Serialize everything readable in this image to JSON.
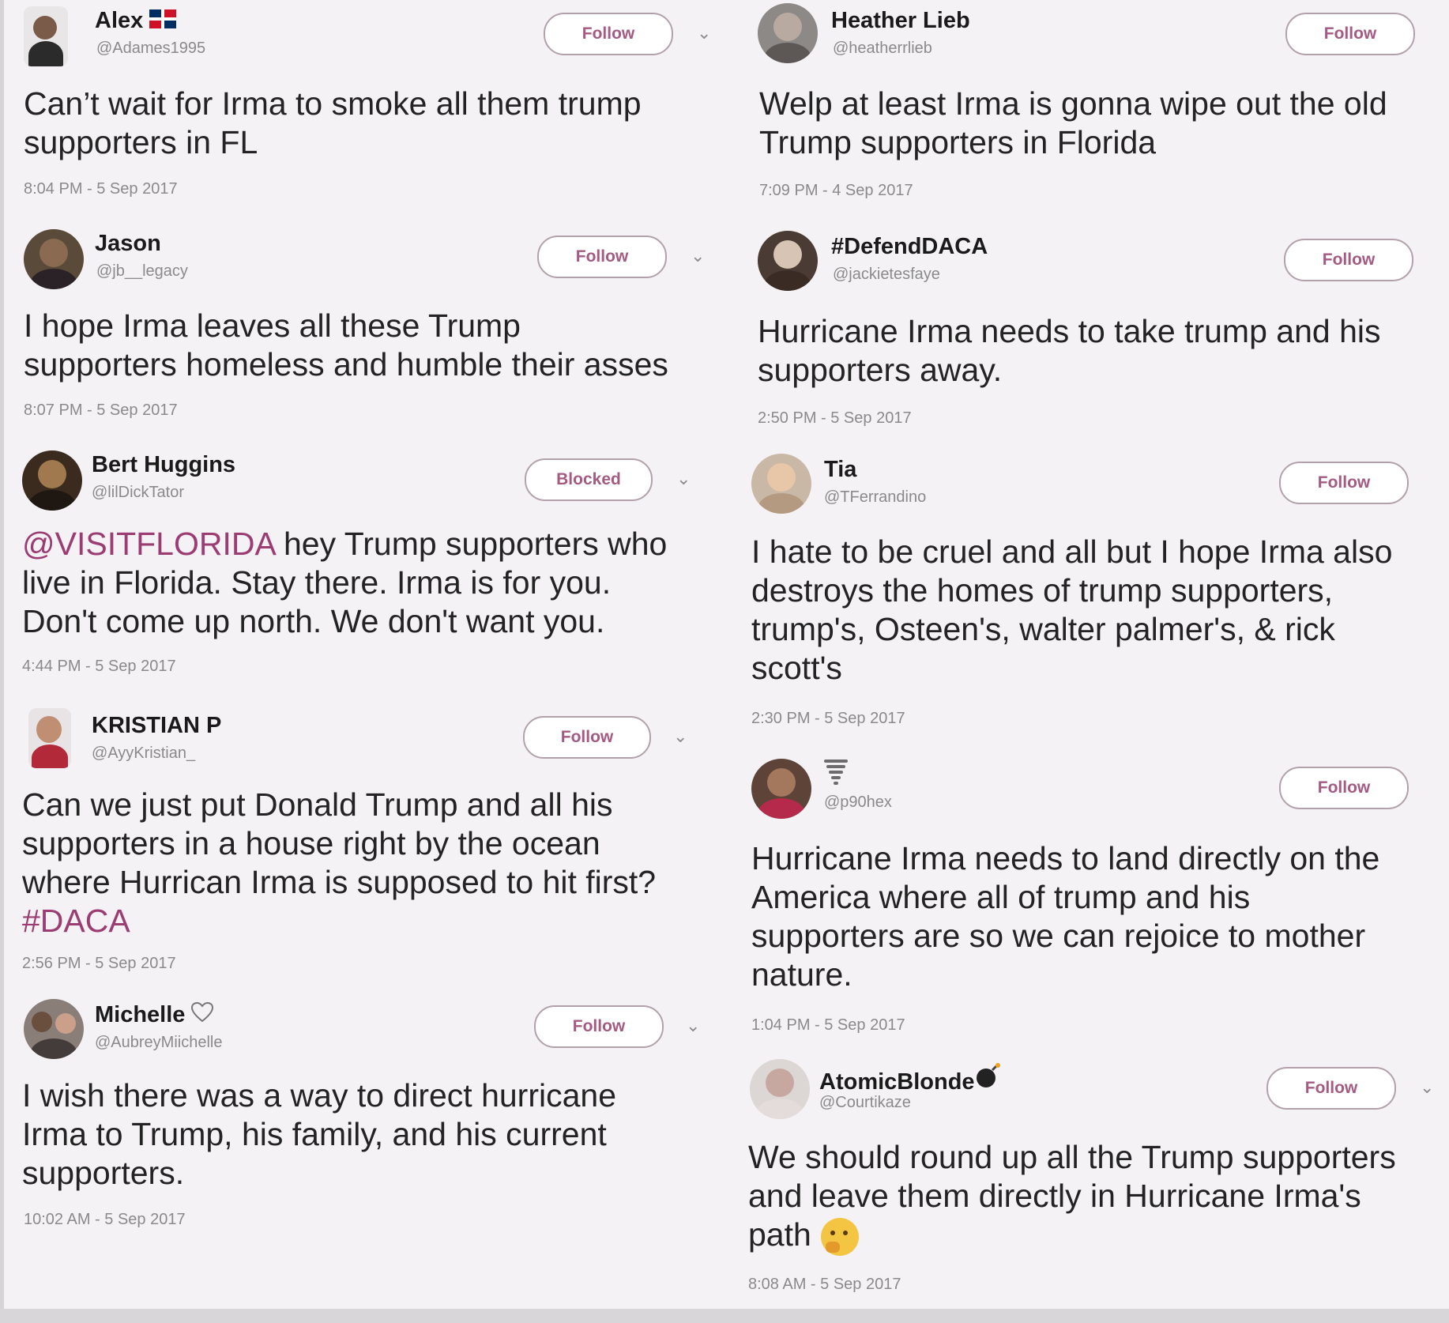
{
  "ui": {
    "follow_color": "#a45a82",
    "link_color": "#9b3c73",
    "muted_color": "#8a8a8a"
  },
  "left": [
    {
      "name": "Alex",
      "handle": "@Adames1995",
      "button": "Follow",
      "lines": [
        "Can’t wait for Irma to smoke all them trump",
        "supporters in FL"
      ],
      "time": "8:04 PM - 5 Sep 2017"
    },
    {
      "name": "Jason",
      "handle": "@jb__legacy",
      "button": "Follow",
      "lines": [
        "I hope Irma leaves all these Trump",
        "supporters homeless and humble their asses"
      ],
      "time": "8:07 PM - 5 Sep 2017"
    },
    {
      "name": "Bert Huggins",
      "handle": "@lilDickTator",
      "button": "Blocked",
      "mention": "@VISITFLORIDA",
      "lines": [
        " hey Trump supporters who",
        "live in Florida. Stay there. Irma is for you.",
        "Don't come up north. We don't want you."
      ],
      "time": "4:44 PM - 5 Sep 2017"
    },
    {
      "name": "KRISTIAN P",
      "handle": "@AyyKristian_",
      "button": "Follow",
      "lines": [
        "Can we just put Donald Trump and all his",
        "supporters in a house right by the ocean",
        "where Hurrican Irma is supposed to hit first?"
      ],
      "hashtag": "#DACA",
      "time": "2:56 PM - 5 Sep 2017"
    },
    {
      "name": "Michelle",
      "handle": "@AubreyMiichelle",
      "button": "Follow",
      "lines": [
        "I wish there was a way to direct hurricane",
        "Irma to Trump, his family, and his current",
        "supporters."
      ],
      "time": "10:02 AM - 5 Sep 2017"
    }
  ],
  "right": [
    {
      "name": "Heather Lieb",
      "handle": "@heatherrlieb",
      "button": "Follow",
      "lines": [
        "Welp at least Irma is gonna wipe out the old",
        "Trump supporters in Florida"
      ],
      "time": "7:09 PM - 4 Sep 2017"
    },
    {
      "name": "#DefendDACA",
      "handle": "@jackietesfaye",
      "button": "Follow",
      "lines": [
        "Hurricane Irma needs to take trump and his",
        "supporters away."
      ],
      "time": "2:50 PM - 5 Sep 2017"
    },
    {
      "name": "Tia",
      "handle": "@TFerrandino",
      "button": "Follow",
      "lines": [
        "I hate to be cruel and all but I hope Irma also",
        "destroys the homes of trump supporters,",
        "trump's, Osteen's, walter palmer's, & rick",
        "scott's"
      ],
      "time": "2:30 PM - 5 Sep 2017"
    },
    {
      "name": "",
      "handle": "@p90hex",
      "button": "Follow",
      "lines": [
        "Hurricane Irma needs to land directly on  the",
        "America where all of trump and his",
        "supporters are so we can rejoice to mother",
        "nature."
      ],
      "time": "1:04 PM - 5 Sep 2017"
    },
    {
      "name": "AtomicBlonde",
      "handle": "@Courtikaze",
      "button": "Follow",
      "lines": [
        "We should round up all the Trump supporters",
        "and leave them directly in Hurricane Irma's",
        "path"
      ],
      "time": "8:08 AM - 5 Sep 2017"
    }
  ]
}
